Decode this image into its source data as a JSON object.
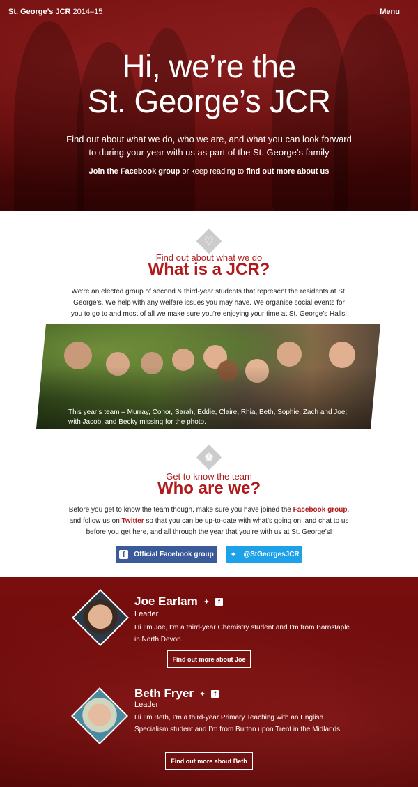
{
  "header": {
    "brand_name": "St. George’s JCR",
    "brand_year": "2014–15",
    "menu_label": "Menu"
  },
  "hero": {
    "title_line1": "Hi, we’re the",
    "title_line2": "St. George’s JCR",
    "lead": "Find out about what we do, who we are, and what you can look forward to during your year with us as part of the St. George’s family",
    "cta_link1": "Join the Facebook group",
    "cta_middle": " or keep reading to ",
    "cta_link2": "find out more about us"
  },
  "what": {
    "icon": "heart-icon",
    "kicker": "Find out about what we do",
    "title": "What is a JCR?",
    "body": "We’re an elected group of second & third-year students that represent the residents at St. George’s. We help with any welfare issues you may have. We organise social events for you to go to and most of all we make sure you’re enjoying your time at St. George’s Halls!",
    "photo_caption": "This year’s team – Murray, Conor, Sarah, Eddie, Claire, Rhia, Beth, Sophie, Zach and Joe; with Jacob, and Becky missing for the photo."
  },
  "who": {
    "icon": "group-icon",
    "kicker": "Get to know the team",
    "title": "Who are we?",
    "body_part1": "Before you get to know the team though, make sure you have joined the ",
    "body_link1": "Facebook group",
    "body_part2": ", and follow us on ",
    "body_link2": "Twitter",
    "body_part3": " so that you can be up-to-date with what’s going on, and chat to us before you get here, and all through the year that you’re with us at St. George’s!",
    "facebook_button": "Official Facebook group",
    "twitter_button": "@StGeorgesJCR"
  },
  "members": [
    {
      "name": "Joe Earlam",
      "role": "Leader",
      "bio": "Hi I’m Joe, I’m a third-year Chemistry student and I’m from Barnstaple in North Devon.",
      "button": "Find out more about Joe"
    },
    {
      "name": "Beth Fryer",
      "role": "Leader",
      "bio": "Hi I’m Beth, I’m a third-year Primary Teaching with an English Specialism student and I’m from Burton upon Trent in the Midlands.",
      "button": "Find out more about Beth"
    }
  ],
  "colors": {
    "accent": "#b01a1a",
    "facebook": "#3b5a9a",
    "twitter": "#1da1e8"
  }
}
